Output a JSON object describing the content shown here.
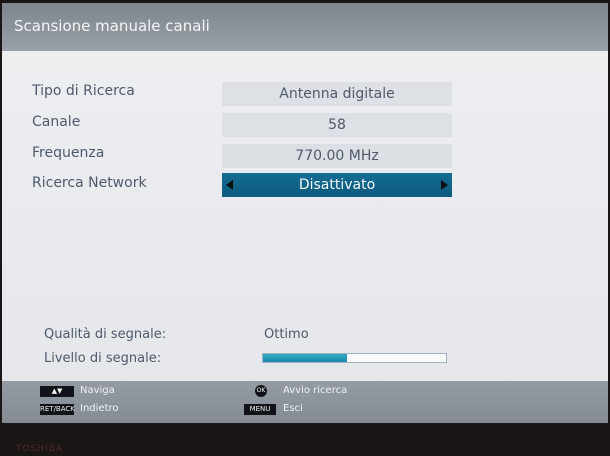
{
  "title": "Scansione manuale canali",
  "settings": [
    {
      "label": "Tipo di Ricerca",
      "value": "Antenna digitale"
    },
    {
      "label": "Canale",
      "value": "58"
    },
    {
      "label": "Frequenza",
      "value": "770.00 MHz"
    },
    {
      "label": "Ricerca Network",
      "value": "Disattivato"
    }
  ],
  "signal": {
    "quality_label": "Qualità di segnale:",
    "quality_value": "Ottimo",
    "level_label": "Livello di segnale:",
    "level_fraction": 0.46
  },
  "footer": {
    "navigate": "Naviga",
    "back": "Indietro",
    "start_scan": "Avvio ricerca",
    "exit": "Esci",
    "back_key": "RET/BACK",
    "ok_key": "OK",
    "menu_key": "MENU"
  },
  "brand": "TOSHIBA",
  "colors": {
    "selected_row": "#136e92",
    "signal_fill": "#33a9c4",
    "title_bar": "#8a9098"
  }
}
